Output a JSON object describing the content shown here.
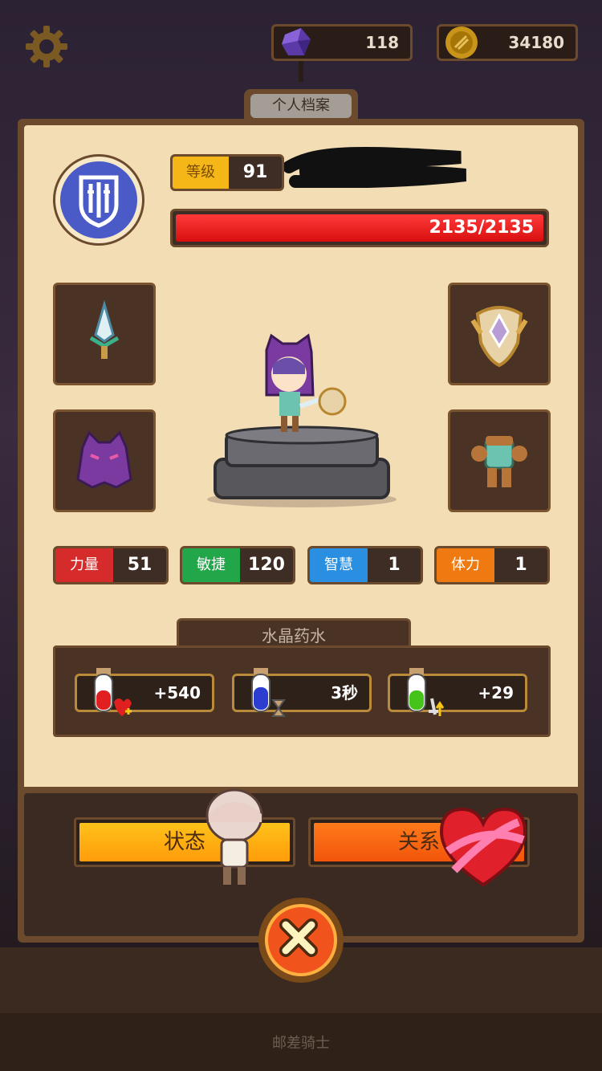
{
  "topbar": {
    "gems": "118",
    "coins": "34180"
  },
  "profile": {
    "tab_label": "个人档案",
    "level_label": "等级",
    "level_value": "91",
    "hp": "2135/2135"
  },
  "stats": [
    {
      "label": "力量",
      "value": "51",
      "color": "#d62b2b"
    },
    {
      "label": "敏捷",
      "value": "120",
      "color": "#22a64a"
    },
    {
      "label": "智慧",
      "value": "1",
      "color": "#2a8fe0"
    },
    {
      "label": "体力",
      "value": "1",
      "color": "#f07a12"
    }
  ],
  "potions": {
    "title": "水晶药水",
    "items": [
      {
        "value": "+540",
        "color": "#e02020"
      },
      {
        "value": "3秒",
        "color": "#2c3ed0"
      },
      {
        "value": "+29",
        "color": "#44c41a"
      }
    ]
  },
  "buttons": {
    "status": "状态",
    "relation": "关系"
  },
  "footer": "邮差骑士"
}
